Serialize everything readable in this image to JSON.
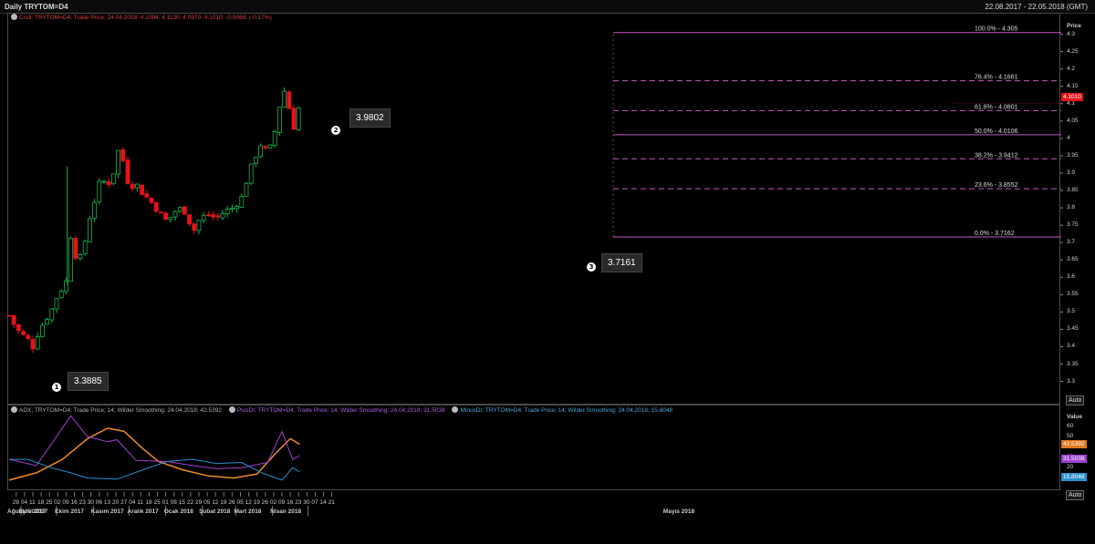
{
  "header": {
    "title": "Daily TRYTOM=D4",
    "date_range": "22.08.2017 - 22.05.2018 (GMT)"
  },
  "main_legend": "Cndl; TRYTOM=D4; Trade Price; 24.04.2018; 4.1094; 4.1130; 4.0970; 4.1010; -0.0068; (-0.17%)",
  "indicator_legends": [
    {
      "text": "ADX; TRYTOM=D4; Trade Price; 14; Wilder Smoothing; 24.04.2018; 42.5392",
      "color": "#b0b0b0"
    },
    {
      "text": "PlusDI; TRYTOM=D4; Trade Price; 14; Wilder Smoothing; 24.04.2018; 31.5038",
      "color": "#b060e0"
    },
    {
      "text": "MinusDI; TRYTOM=D4; Trade Price; 14; Wilder Smoothing; 24.04.2018; 15.8048",
      "color": "#4aa8e0"
    }
  ],
  "price_axis": {
    "title": "Price",
    "ticks": [
      "4.3",
      "4.25",
      "4.2",
      "4.15",
      "4.1",
      "4.05",
      "4",
      "3.95",
      "3.9",
      "3.85",
      "3.8",
      "3.75",
      "3.7",
      "3.65",
      "3.6",
      "3.55",
      "3.5",
      "3.45",
      "3.4",
      "3.35",
      "3.3"
    ],
    "last_price": "4.1010",
    "auto_label": "Auto"
  },
  "value_axis": {
    "title": "Value",
    "ticks": [
      "60",
      "50",
      "40",
      "30",
      "20",
      "10"
    ],
    "tags": [
      {
        "text": "42.5392",
        "color": "#e07a20"
      },
      {
        "text": "31.5038",
        "color": "#a040d0"
      },
      {
        "text": "15.8048",
        "color": "#2a90d0"
      }
    ],
    "auto_label": "Auto"
  },
  "date_axis": {
    "days": [
      "28",
      "04",
      "11",
      "18",
      "25",
      "02",
      "09",
      "16",
      "23",
      "30",
      "06",
      "13",
      "20",
      "27",
      "04",
      "11",
      "18",
      "25",
      "01",
      "08",
      "15",
      "22",
      "29",
      "05",
      "12",
      "19",
      "26",
      "05",
      "12",
      "19",
      "26",
      "02",
      "09",
      "16",
      "23",
      "30",
      "07",
      "14",
      "21"
    ],
    "months": [
      "Ağustos 2017",
      "Eylül 2017",
      "Ekim 2017",
      "Kasım 2017",
      "Aralık 2017",
      "Ocak 2018",
      "Şubat 2018",
      "Mart 2018",
      "Nisan 2018",
      "Mayıs 2018"
    ]
  },
  "fibonacci": [
    {
      "label": "100.0%",
      "value": "4.305"
    },
    {
      "label": "76.4%",
      "value": "4.1661"
    },
    {
      "label": "61.8%",
      "value": "4.0801"
    },
    {
      "label": "50.0%",
      "value": "4.0106"
    },
    {
      "label": "38.2%",
      "value": "3.9412"
    },
    {
      "label": "23.6%",
      "value": "3.8552"
    },
    {
      "label": "0.0%",
      "value": "3.7162"
    }
  ],
  "callouts": [
    {
      "marker": "1",
      "value": "3.3885"
    },
    {
      "marker": "2",
      "value": "3.9802"
    },
    {
      "marker": "3",
      "value": "3.7161"
    }
  ],
  "colors": {
    "up": "#19b34a",
    "down": "#e8121b",
    "fib": "#c45ac4",
    "adx": "#f08a30",
    "plusdi": "#a040d0",
    "minusdi": "#2a90d0"
  },
  "chart_data": {
    "type": "candlestick",
    "title": "Daily TRYTOM=D4",
    "ylabel": "Price",
    "ylim": [
      3.27,
      4.32
    ],
    "close_path": [
      [
        "2017-08-22",
        3.49
      ],
      [
        "2017-08-25",
        3.47
      ],
      [
        "2017-08-31",
        3.44
      ],
      [
        "2017-09-07",
        3.42
      ],
      [
        "2017-09-11",
        3.4
      ],
      [
        "2017-09-14",
        3.43
      ],
      [
        "2017-09-20",
        3.47
      ],
      [
        "2017-09-26",
        3.5
      ],
      [
        "2017-10-02",
        3.55
      ],
      [
        "2017-10-06",
        3.57
      ],
      [
        "2017-10-11",
        3.6
      ],
      [
        "2017-10-13",
        3.72
      ],
      [
        "2017-10-18",
        3.65
      ],
      [
        "2017-10-23",
        3.66
      ],
      [
        "2017-10-27",
        3.75
      ],
      [
        "2017-11-02",
        3.82
      ],
      [
        "2017-11-07",
        3.88
      ],
      [
        "2017-11-13",
        3.87
      ],
      [
        "2017-11-17",
        3.88
      ],
      [
        "2017-11-21",
        3.97
      ],
      [
        "2017-11-27",
        3.93
      ],
      [
        "2017-12-01",
        3.86
      ],
      [
        "2017-12-07",
        3.87
      ],
      [
        "2017-12-13",
        3.84
      ],
      [
        "2017-12-19",
        3.82
      ],
      [
        "2017-12-26",
        3.79
      ],
      [
        "2018-01-02",
        3.76
      ],
      [
        "2018-01-09",
        3.79
      ],
      [
        "2018-01-15",
        3.8
      ],
      [
        "2018-01-19",
        3.78
      ],
      [
        "2018-01-24",
        3.73
      ],
      [
        "2018-01-30",
        3.77
      ],
      [
        "2018-02-06",
        3.78
      ],
      [
        "2018-02-13",
        3.77
      ],
      [
        "2018-02-20",
        3.79
      ],
      [
        "2018-02-27",
        3.8
      ],
      [
        "2018-03-06",
        3.83
      ],
      [
        "2018-03-12",
        3.9
      ],
      [
        "2018-03-19",
        3.96
      ],
      [
        "2018-03-23",
        3.99
      ],
      [
        "2018-03-28",
        3.95
      ],
      [
        "2018-04-03",
        4.02
      ],
      [
        "2018-04-09",
        4.13
      ],
      [
        "2018-04-12",
        4.14
      ],
      [
        "2018-04-16",
        4.07
      ],
      [
        "2018-04-18",
        4.02
      ],
      [
        "2018-04-24",
        4.101
      ]
    ],
    "annotations": [
      {
        "label": "1",
        "value": 3.3885
      },
      {
        "label": "2",
        "value": 3.9802
      },
      {
        "label": "3",
        "value": 3.7161
      }
    ],
    "indicators": {
      "type": "line",
      "ylim": [
        0,
        65
      ],
      "series": [
        {
          "name": "ADX",
          "last": 42.5392,
          "values": [
            [
              "2017-08-22",
              8
            ],
            [
              "2017-09-14",
              15
            ],
            [
              "2017-10-06",
              28
            ],
            [
              "2017-10-27",
              48
            ],
            [
              "2017-11-13",
              58
            ],
            [
              "2017-11-27",
              55
            ],
            [
              "2017-12-13",
              38
            ],
            [
              "2017-12-26",
              26
            ],
            [
              "2018-01-15",
              18
            ],
            [
              "2018-02-06",
              12
            ],
            [
              "2018-02-27",
              10
            ],
            [
              "2018-03-19",
              14
            ],
            [
              "2018-04-03",
              33
            ],
            [
              "2018-04-16",
              48
            ],
            [
              "2018-04-24",
              42.5
            ]
          ]
        },
        {
          "name": "PlusDI",
          "last": 31.5038,
          "values": [
            [
              "2017-08-22",
              28
            ],
            [
              "2017-09-14",
              22
            ],
            [
              "2017-10-13",
              70
            ],
            [
              "2017-10-27",
              50
            ],
            [
              "2017-11-13",
              45
            ],
            [
              "2017-11-21",
              47
            ],
            [
              "2017-12-07",
              27
            ],
            [
              "2018-01-02",
              26
            ],
            [
              "2018-01-24",
              22
            ],
            [
              "2018-02-13",
              19
            ],
            [
              "2018-03-06",
              20
            ],
            [
              "2018-03-28",
              25
            ],
            [
              "2018-04-09",
              55
            ],
            [
              "2018-04-18",
              28
            ],
            [
              "2018-04-24",
              31.5
            ]
          ]
        },
        {
          "name": "MinusDI",
          "last": 15.8048,
          "values": [
            [
              "2017-08-22",
              28
            ],
            [
              "2017-09-07",
              28
            ],
            [
              "2017-09-26",
              20
            ],
            [
              "2017-10-13",
              15
            ],
            [
              "2017-10-27",
              10
            ],
            [
              "2017-11-21",
              9
            ],
            [
              "2017-12-13",
              18
            ],
            [
              "2018-01-02",
              26
            ],
            [
              "2018-01-24",
              28
            ],
            [
              "2018-02-13",
              24
            ],
            [
              "2018-03-06",
              25
            ],
            [
              "2018-03-23",
              15
            ],
            [
              "2018-04-09",
              8
            ],
            [
              "2018-04-18",
              20
            ],
            [
              "2018-04-24",
              15.8
            ]
          ]
        }
      ]
    }
  }
}
